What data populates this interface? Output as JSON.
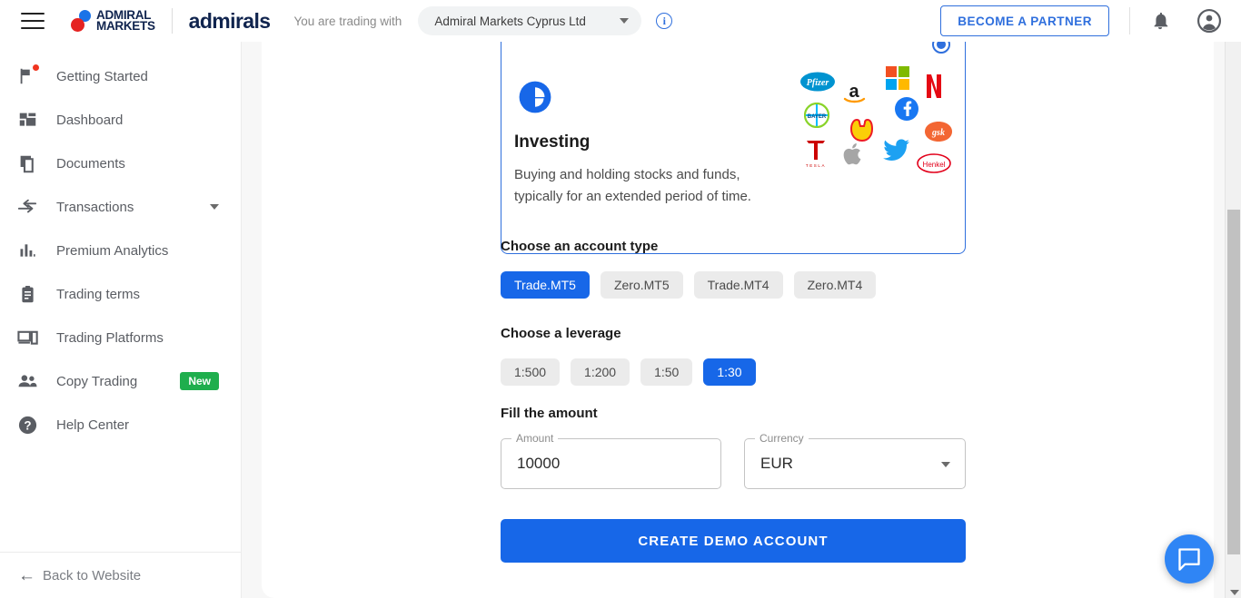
{
  "header": {
    "menu_icon": "hamburger-menu-icon",
    "brand_logo": "admiral-markets-logo",
    "brand_line1": "ADMIRAL",
    "brand_line2": "MARKETS",
    "brand_word": "admirals",
    "trading_with_label": "You are trading with",
    "entity_value": "Admiral Markets Cyprus Ltd",
    "info_icon_glyph": "i",
    "partner_button": "BECOME A PARTNER",
    "notifications_icon": "bell-icon",
    "account_icon": "user-avatar-icon"
  },
  "sidebar": {
    "items": [
      {
        "label": "Getting Started",
        "icon": "flag-icon",
        "badge": "",
        "has_dot": true,
        "has_caret": false
      },
      {
        "label": "Dashboard",
        "icon": "dashboard-grid-icon",
        "badge": "",
        "has_dot": false,
        "has_caret": false
      },
      {
        "label": "Documents",
        "icon": "documents-icon",
        "badge": "",
        "has_dot": false,
        "has_caret": false
      },
      {
        "label": "Transactions",
        "icon": "transactions-arrows-icon",
        "badge": "",
        "has_dot": false,
        "has_caret": true
      },
      {
        "label": "Premium Analytics",
        "icon": "bar-chart-icon",
        "badge": "",
        "has_dot": false,
        "has_caret": false
      },
      {
        "label": "Trading terms",
        "icon": "clipboard-icon",
        "badge": "",
        "has_dot": false,
        "has_caret": false
      },
      {
        "label": "Trading Platforms",
        "icon": "devices-icon",
        "badge": "",
        "has_dot": false,
        "has_caret": false
      },
      {
        "label": "Copy Trading",
        "icon": "people-icon",
        "badge": "New",
        "has_dot": false,
        "has_caret": false
      },
      {
        "label": "Help Center",
        "icon": "help-question-icon",
        "badge": "",
        "has_dot": false,
        "has_caret": false
      }
    ],
    "footer_label": "Back to Website",
    "footer_icon": "arrow-left-icon"
  },
  "main": {
    "product_card": {
      "icon": "pie-chart-icon",
      "title": "Investing",
      "description": "Buying and holding stocks and funds, typically for an extended period of time.",
      "selected": true,
      "brand_logos": [
        "pfizer-logo",
        "amazon-logo",
        "microsoft-logo",
        "netflix-logo",
        "bayer-logo",
        "shell-logo",
        "facebook-logo",
        "gsk-logo",
        "tesla-logo",
        "apple-logo",
        "twitter-logo",
        "henkel-logo"
      ]
    },
    "account_type": {
      "heading": "Choose an account type",
      "options": [
        "Trade.MT5",
        "Zero.MT5",
        "Trade.MT4",
        "Zero.MT4"
      ],
      "selected": "Trade.MT5"
    },
    "leverage": {
      "heading": "Choose a leverage",
      "options": [
        "1:500",
        "1:200",
        "1:50",
        "1:30"
      ],
      "selected": "1:30"
    },
    "amount_section": {
      "heading": "Fill the amount",
      "amount_label": "Amount",
      "amount_value": "10000",
      "currency_label": "Currency",
      "currency_value": "EUR"
    },
    "submit_button": "CREATE DEMO ACCOUNT"
  },
  "widgets": {
    "chat_icon": "chat-bubble-icon"
  },
  "colors": {
    "accent_blue": "#1767e8",
    "brand_navy": "#10244e",
    "badge_green": "#1fae4d",
    "chip_grey": "#ebebeb"
  }
}
